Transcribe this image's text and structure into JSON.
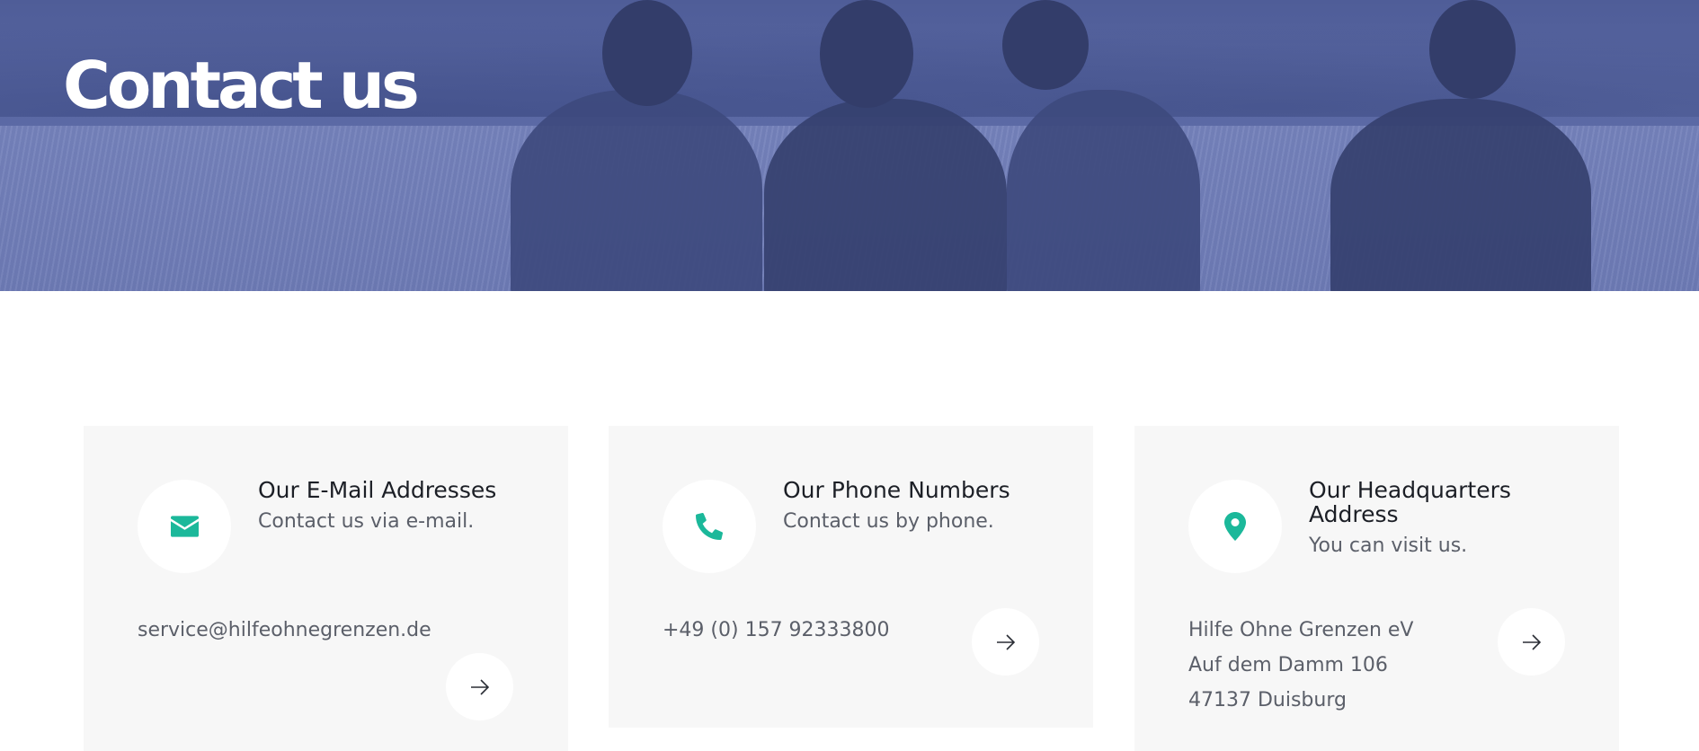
{
  "hero": {
    "title": "Contact us"
  },
  "colors": {
    "accent": "#1bb89a",
    "hero_overlay": "#5c6aa6",
    "card_bg": "#f7f7f7"
  },
  "cards": [
    {
      "icon": "envelope-icon",
      "title": "Our E-Mail Addresses",
      "subtitle": "Contact us via e-mail.",
      "lines": [
        "service@hilfeohnegrenzen.de"
      ]
    },
    {
      "icon": "phone-icon",
      "title": "Our Phone Numbers",
      "subtitle": "Contact us by phone.",
      "lines": [
        "+49 (0) 157 92333800"
      ]
    },
    {
      "icon": "map-pin-icon",
      "title": "Our Headquarters Address",
      "subtitle": "You can visit us.",
      "lines": [
        "Hilfe Ohne Grenzen eV",
        "Auf dem Damm 106",
        "47137 Duisburg"
      ]
    }
  ]
}
